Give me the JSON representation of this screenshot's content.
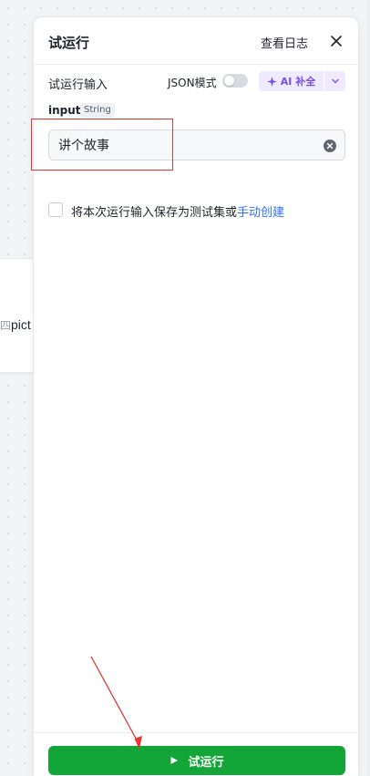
{
  "canvas": {
    "node_fragment_text": "pict",
    "node_fragment_prefix": "四"
  },
  "panel": {
    "title": "试运行",
    "view_log_label": "查看日志",
    "close_icon": "close-icon"
  },
  "input_section": {
    "label": "试运行输入",
    "json_mode_label": "JSON模式",
    "json_mode_on": false,
    "ai_button_label": "AI 补全",
    "ai_icon": "sparkle-icon",
    "field": {
      "name": "input",
      "type": "String",
      "value": "讲个故事"
    }
  },
  "save_option": {
    "checked": false,
    "text": "将本次运行输入保存为测试集或",
    "link": "手动创建"
  },
  "footer": {
    "run_button_label": "试运行",
    "run_icon": "play-icon"
  },
  "colors": {
    "primary_green": "#13a538",
    "ai_purple": "#7a4df0",
    "link_blue": "#3370ff",
    "annotation_red": "#e53935"
  }
}
